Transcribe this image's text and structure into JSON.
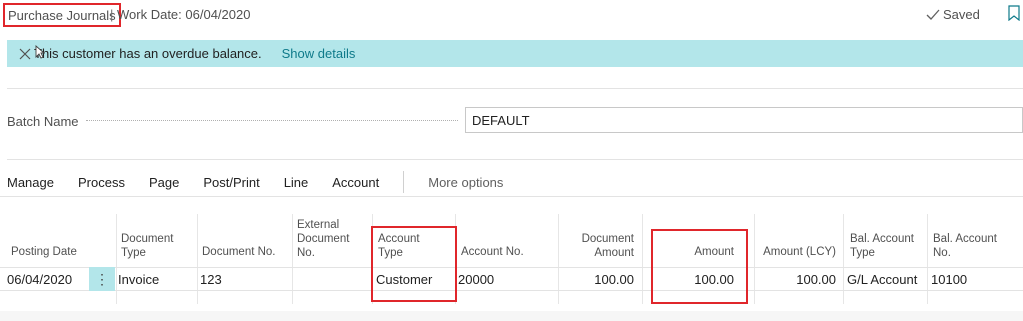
{
  "header": {
    "title": "Purchase Journals",
    "separator": "|",
    "work_date": "Work Date: 06/04/2020",
    "saved_label": "Saved"
  },
  "banner": {
    "message": "This customer has an overdue balance.",
    "link": "Show details"
  },
  "batch": {
    "label": "Batch Name",
    "value": "DEFAULT"
  },
  "actions": {
    "items": [
      "Manage",
      "Process",
      "Page",
      "Post/Print",
      "Line",
      "Account"
    ],
    "more": "More options"
  },
  "grid": {
    "columns": [
      "Posting Date",
      "Document\nType",
      "Document No.",
      "External\nDocument\nNo.",
      "Account\nType",
      "Account No.",
      "Document\nAmount",
      "Amount",
      "Amount (LCY)",
      "Bal. Account\nType",
      "Bal. Account\nNo."
    ],
    "rows": [
      {
        "posting_date": "06/04/2020",
        "document_type": "Invoice",
        "document_no": "123",
        "external_document_no": "",
        "account_type": "Customer",
        "account_no": "20000",
        "document_amount": "100.00",
        "amount": "100.00",
        "amount_lcy": "100.00",
        "bal_account_type": "G/L Account",
        "bal_account_no": "10100"
      }
    ]
  },
  "colors": {
    "banner_bg": "#b3e6ea",
    "highlight_border": "#e0262b",
    "link": "#0e7a8a"
  }
}
